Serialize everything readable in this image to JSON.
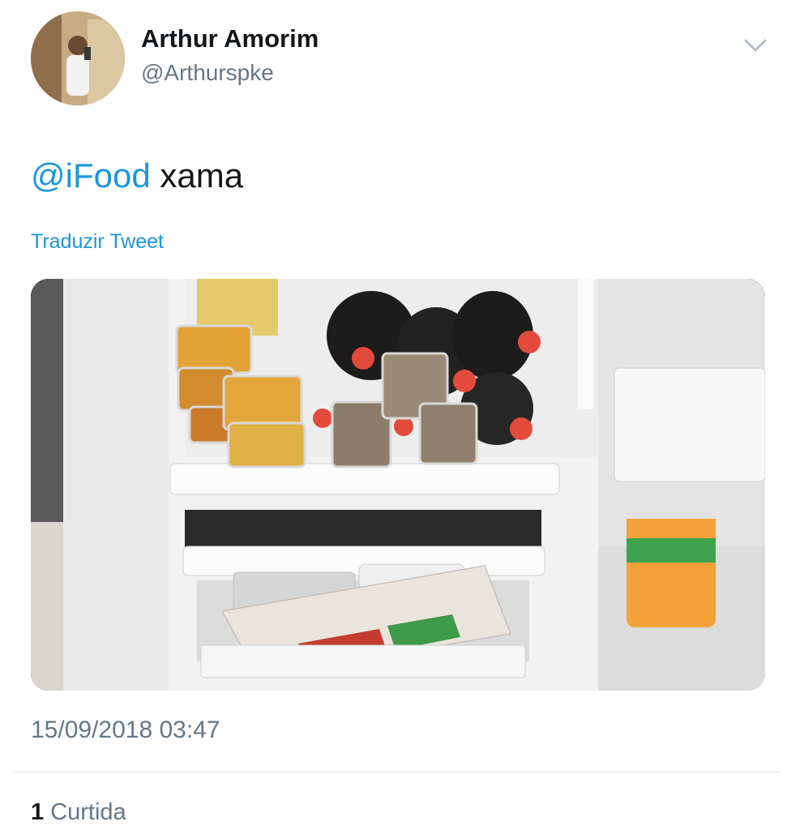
{
  "tweet": {
    "author_name": "Arthur Amorim",
    "author_handle": "@Arthurspke",
    "mention": "@iFood",
    "text": "xama",
    "translate_label": "Traduzir Tweet",
    "timestamp": "15/09/2018 03:47",
    "likes_count": "1",
    "likes_label": "Curtida"
  },
  "icons": {
    "menu": "chevron-down-icon"
  },
  "colors": {
    "link": "#1b95e0",
    "secondary_text": "#657786",
    "primary_text": "#14171a"
  }
}
